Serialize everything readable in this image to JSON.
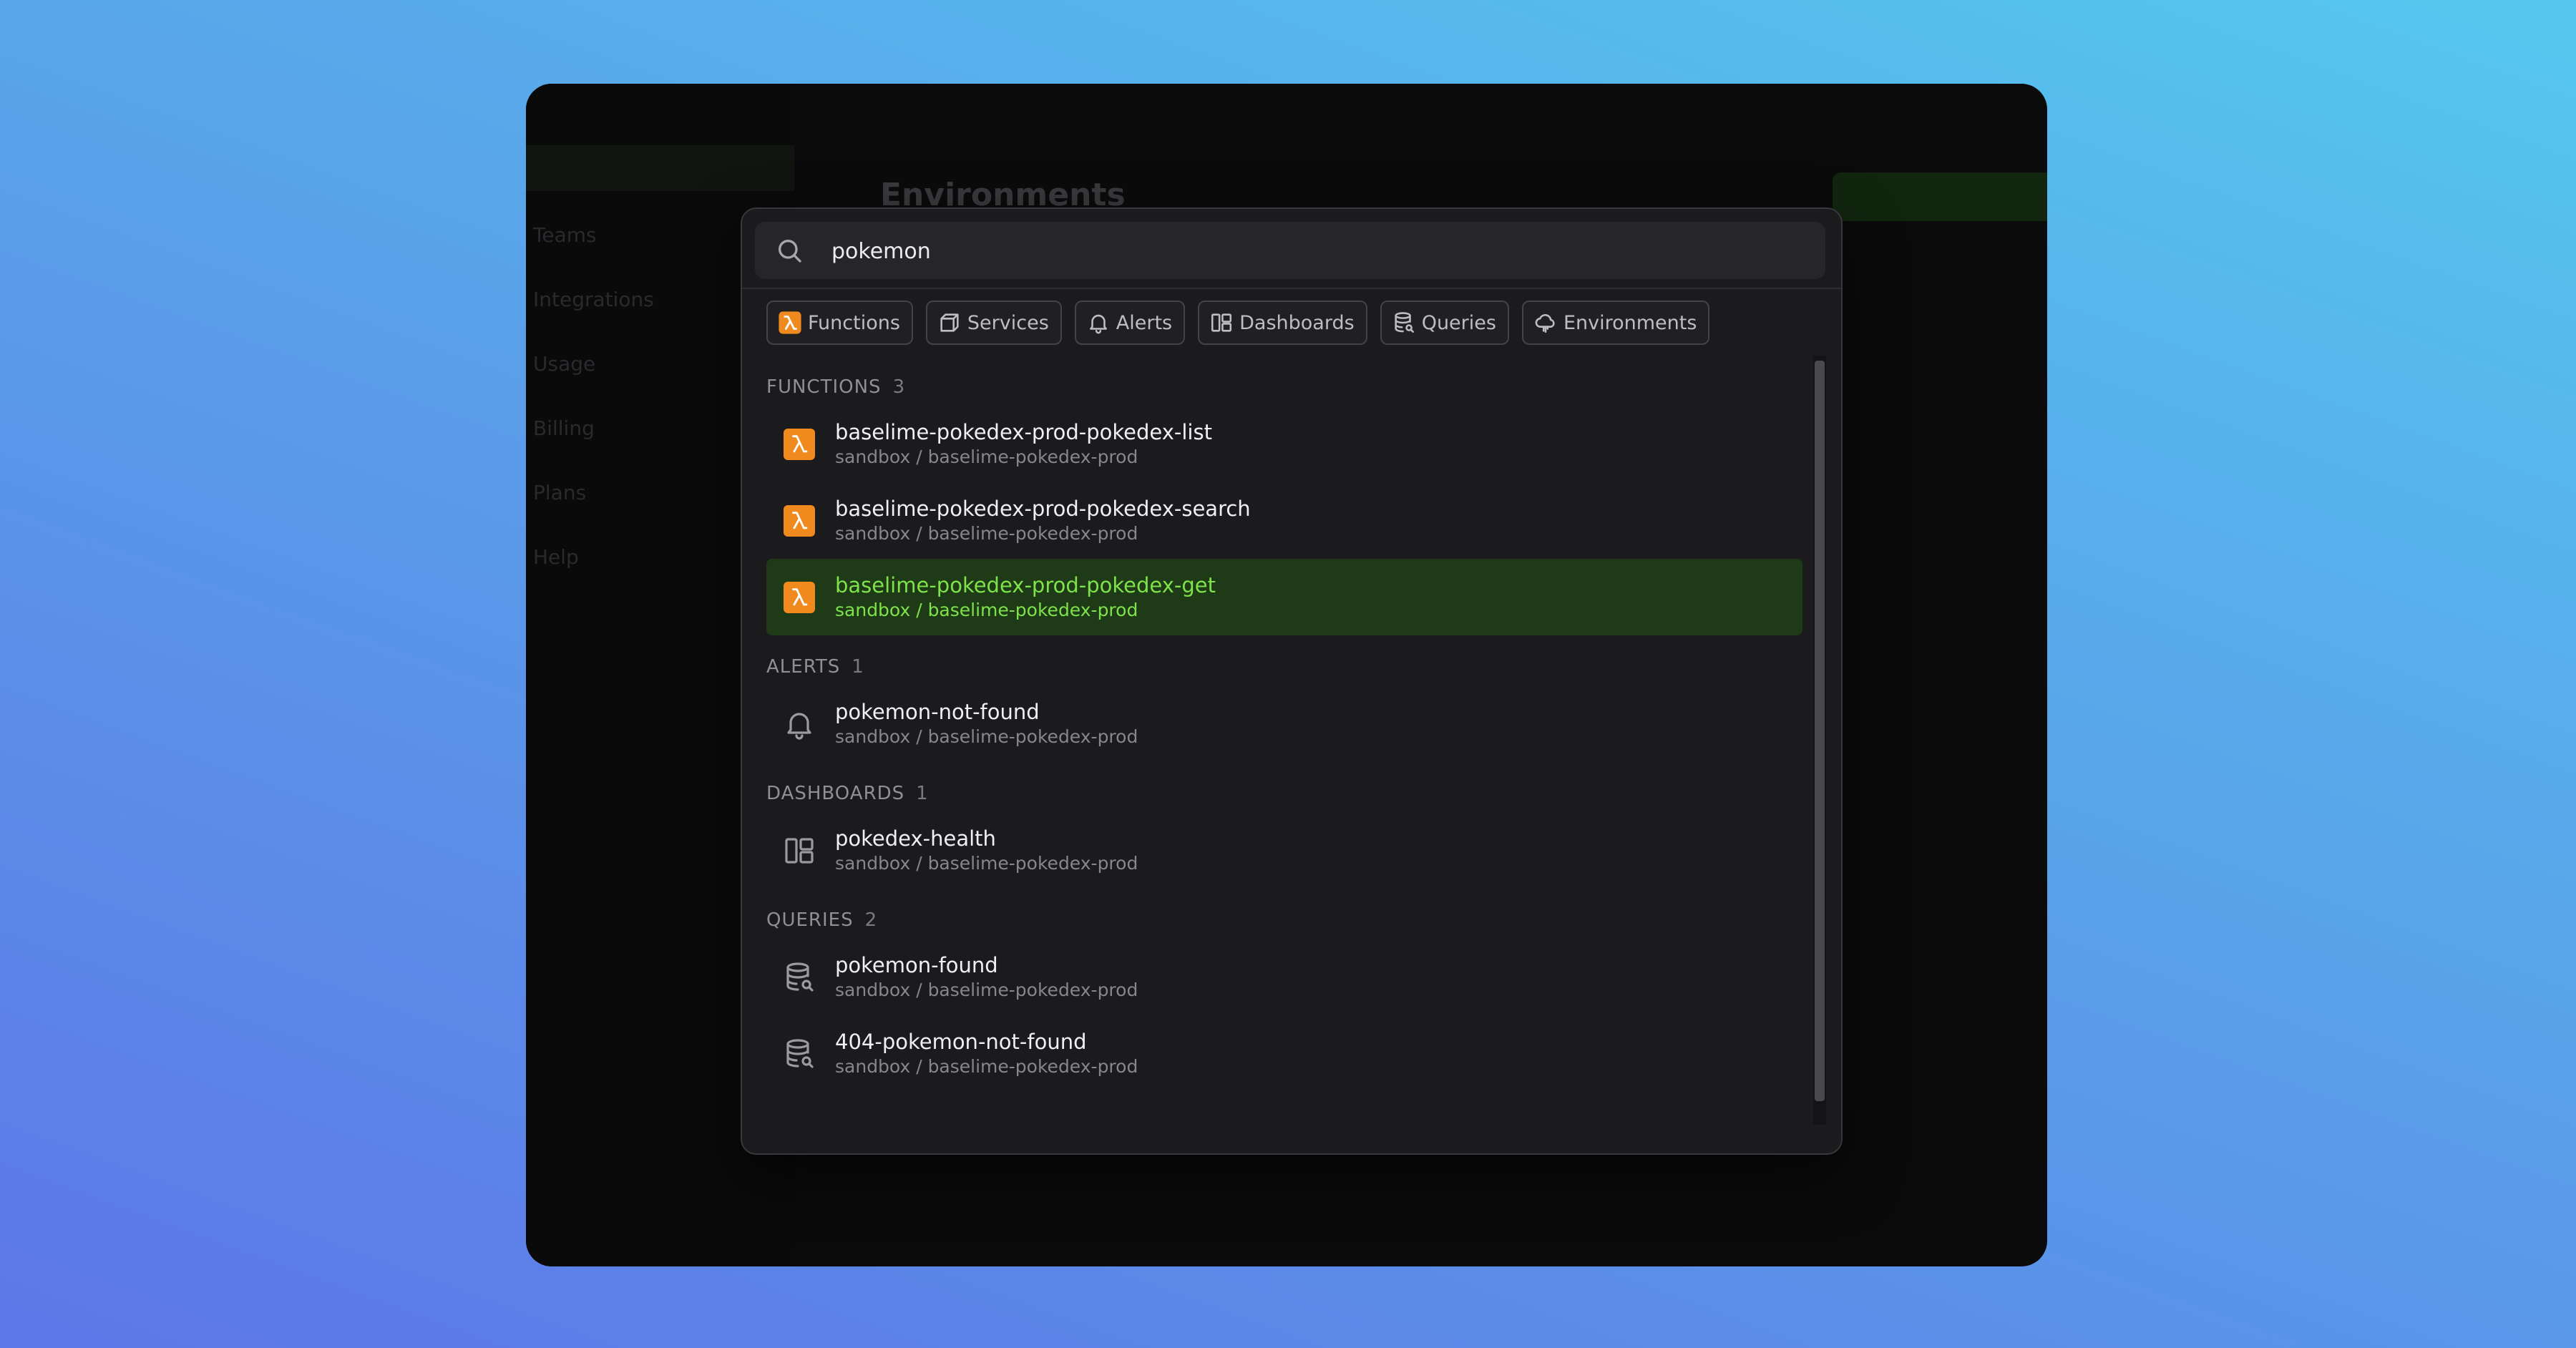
{
  "background_app": {
    "heading": "Environments",
    "sidebar_items": [
      "Teams",
      "Integrations",
      "Usage",
      "Billing",
      "Plans",
      "Help"
    ]
  },
  "search": {
    "query": "pokemon",
    "placeholder": ""
  },
  "filters": [
    {
      "label": "Functions",
      "icon": "lambda-icon"
    },
    {
      "label": "Services",
      "icon": "box-icon"
    },
    {
      "label": "Alerts",
      "icon": "bell-icon"
    },
    {
      "label": "Dashboards",
      "icon": "dashboard-icon"
    },
    {
      "label": "Queries",
      "icon": "database-search-icon"
    },
    {
      "label": "Environments",
      "icon": "cloud-icon"
    }
  ],
  "sections": {
    "functions": {
      "title": "FUNCTIONS",
      "count": "3",
      "items": [
        {
          "title": "baselime-pokedex-prod-pokedex-list",
          "subtitle": "sandbox / baselime-pokedex-prod"
        },
        {
          "title": "baselime-pokedex-prod-pokedex-search",
          "subtitle": "sandbox / baselime-pokedex-prod"
        },
        {
          "title": "baselime-pokedex-prod-pokedex-get",
          "subtitle": "sandbox / baselime-pokedex-prod"
        }
      ]
    },
    "alerts": {
      "title": "ALERTS",
      "count": "1",
      "items": [
        {
          "title": "pokemon-not-found",
          "subtitle": "sandbox / baselime-pokedex-prod"
        }
      ]
    },
    "dashboards": {
      "title": "DASHBOARDS",
      "count": "1",
      "items": [
        {
          "title": "pokedex-health",
          "subtitle": "sandbox / baselime-pokedex-prod"
        }
      ]
    },
    "queries": {
      "title": "QUERIES",
      "count": "2",
      "items": [
        {
          "title": "pokemon-found",
          "subtitle": "sandbox / baselime-pokedex-prod"
        },
        {
          "title": "404-pokemon-not-found",
          "subtitle": "sandbox / baselime-pokedex-prod"
        }
      ]
    }
  },
  "colors": {
    "accent_green": "#7ee24a",
    "selected_row_bg": "#1f3a16",
    "function_badge": "#f08a1e"
  }
}
